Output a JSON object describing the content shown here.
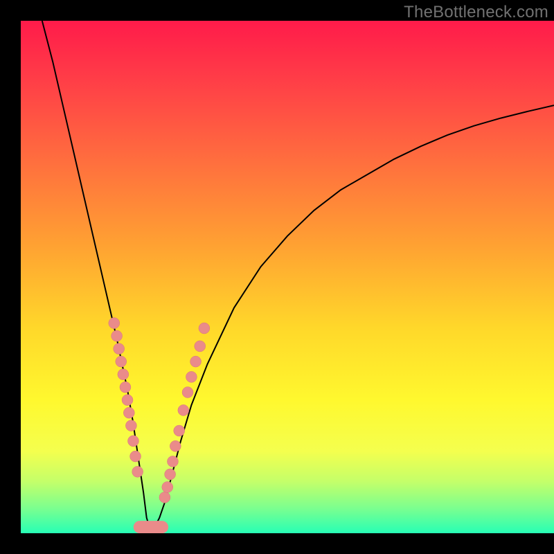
{
  "watermark": {
    "text": "TheBottleneck.com"
  },
  "colors": {
    "curve_stroke": "#000000",
    "marker_fill": "#ea8b8a",
    "marker_stroke": "#d67879",
    "bottom_highlight": "#ea8b8a"
  },
  "chart_data": {
    "type": "line",
    "title": "",
    "xlabel": "",
    "ylabel": "",
    "xlim": [
      0,
      100
    ],
    "ylim": [
      0,
      100
    ],
    "grid": false,
    "series": [
      {
        "name": "bottleneck-curve",
        "x": [
          4,
          6,
          8,
          10,
          12,
          14,
          16,
          18,
          20,
          21,
          22,
          23,
          23.6,
          24.2,
          25,
          26,
          27,
          28,
          29,
          30,
          32,
          35,
          40,
          45,
          50,
          55,
          60,
          65,
          70,
          75,
          80,
          85,
          90,
          95,
          100
        ],
        "y": [
          100,
          92,
          83,
          74,
          65,
          56,
          47,
          38,
          28,
          22,
          15,
          8,
          3,
          1,
          1,
          3,
          6,
          10,
          14,
          18,
          25,
          33,
          44,
          52,
          58,
          63,
          67,
          70,
          73,
          75.5,
          77.7,
          79.5,
          81,
          82.3,
          83.5
        ]
      }
    ],
    "markers_left": {
      "name": "left-cluster",
      "x": [
        17.5,
        18.0,
        18.4,
        18.8,
        19.2,
        19.6,
        20.0,
        20.3,
        20.7,
        21.1,
        21.5,
        21.9
      ],
      "y": [
        41,
        38.5,
        36,
        33.5,
        31,
        28.5,
        26,
        23.5,
        21,
        18,
        15,
        12
      ]
    },
    "markers_right": {
      "name": "right-cluster",
      "x": [
        27.0,
        27.5,
        28.0,
        28.5,
        29.0,
        29.7,
        30.5,
        31.3,
        32.0,
        32.8,
        33.6,
        34.4
      ],
      "y": [
        7,
        9,
        11.5,
        14,
        17,
        20,
        24,
        27.5,
        30.5,
        33.5,
        36.5,
        40
      ]
    },
    "bottom_highlight": {
      "name": "valley-floor",
      "x_start": 22.3,
      "x_end": 26.5,
      "y": 1.2
    }
  }
}
